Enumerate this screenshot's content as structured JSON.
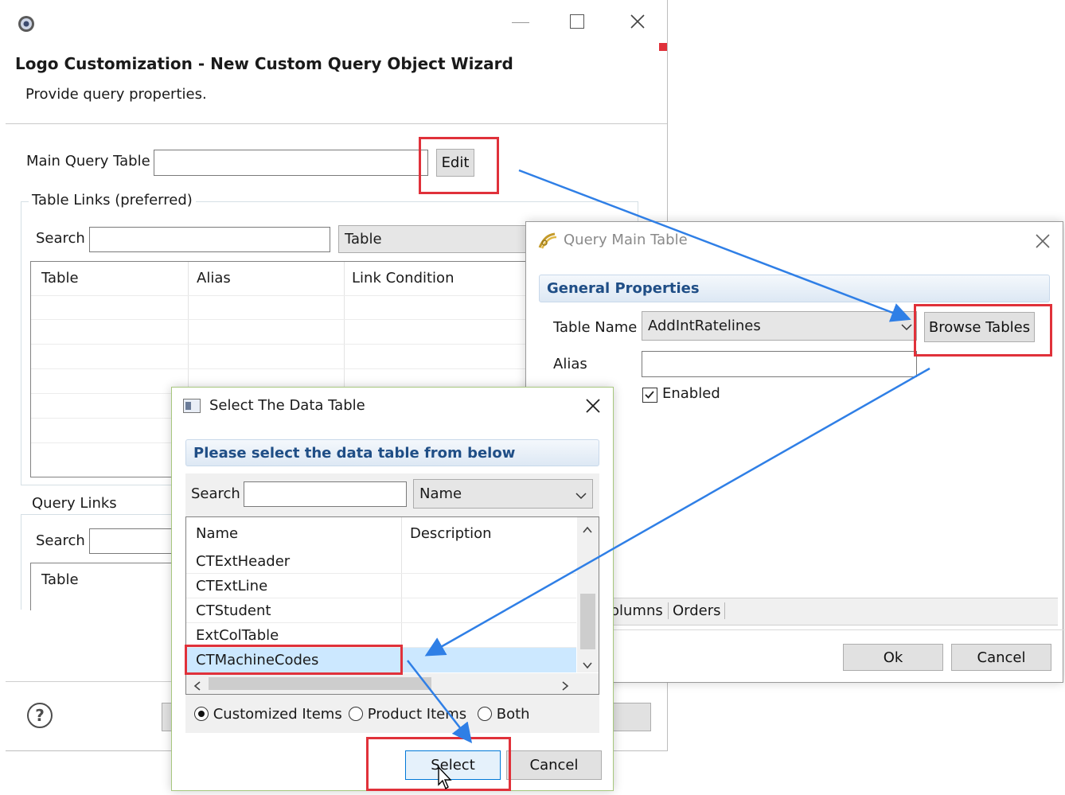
{
  "wizard": {
    "title": "Logo Customization - New Custom Query Object Wizard",
    "subtitle": "Provide query properties.",
    "main_query_table_label": "Main Query Table",
    "main_query_table_value": "",
    "edit_label": "Edit",
    "table_links_title": "Table Links (preferred)",
    "search_label": "Search",
    "search_value": "",
    "search_combo": "Table",
    "columns": [
      "Table",
      "Alias",
      "Link Condition"
    ],
    "query_links_title": "Query Links",
    "query_search_label": "Search",
    "query_column": "Table",
    "help_icon_glyph": "?"
  },
  "query_main_table": {
    "title": "Query Main Table",
    "section": "General Properties",
    "table_name_label": "Table Name",
    "table_name_value": "AddIntRatelines",
    "browse_label": "Browse Tables",
    "alias_label": "Alias",
    "alias_value": "",
    "enabled_label": "Enabled",
    "enabled_checked": true,
    "tab_columns": "olumns",
    "tab_orders": "Orders",
    "ok_label": "Ok",
    "cancel_label": "Cancel"
  },
  "select_dialog": {
    "title": "Select The Data Table",
    "section": "Please select the data table from below",
    "search_label": "Search",
    "search_value": "",
    "search_combo": "Name",
    "columns": [
      "Name",
      "Description"
    ],
    "rows": [
      "CTExtHeader",
      "CTExtLine",
      "CTStudent",
      "ExtColTable",
      "CTMachineCodes"
    ],
    "selected_row": "CTMachineCodes",
    "radio_customized": "Customized Items",
    "radio_product": "Product Items",
    "radio_both": "Both",
    "selected_radio": "Customized Items",
    "select_label": "Select",
    "cancel_label": "Cancel"
  },
  "colors": {
    "highlight": "#e0313a",
    "arrow": "#2f7fe6",
    "selection": "#cce8ff",
    "section_text": "#1f4e86"
  },
  "icons": [
    "app-icon",
    "minimize-icon",
    "maximize-icon",
    "close-icon",
    "help-icon",
    "query-table-icon",
    "table-window-icon",
    "checkbox-icon",
    "chevron-down-icon",
    "chevron-up-icon",
    "arrow-left-icon",
    "arrow-right-icon",
    "mouse-cursor-icon"
  ]
}
